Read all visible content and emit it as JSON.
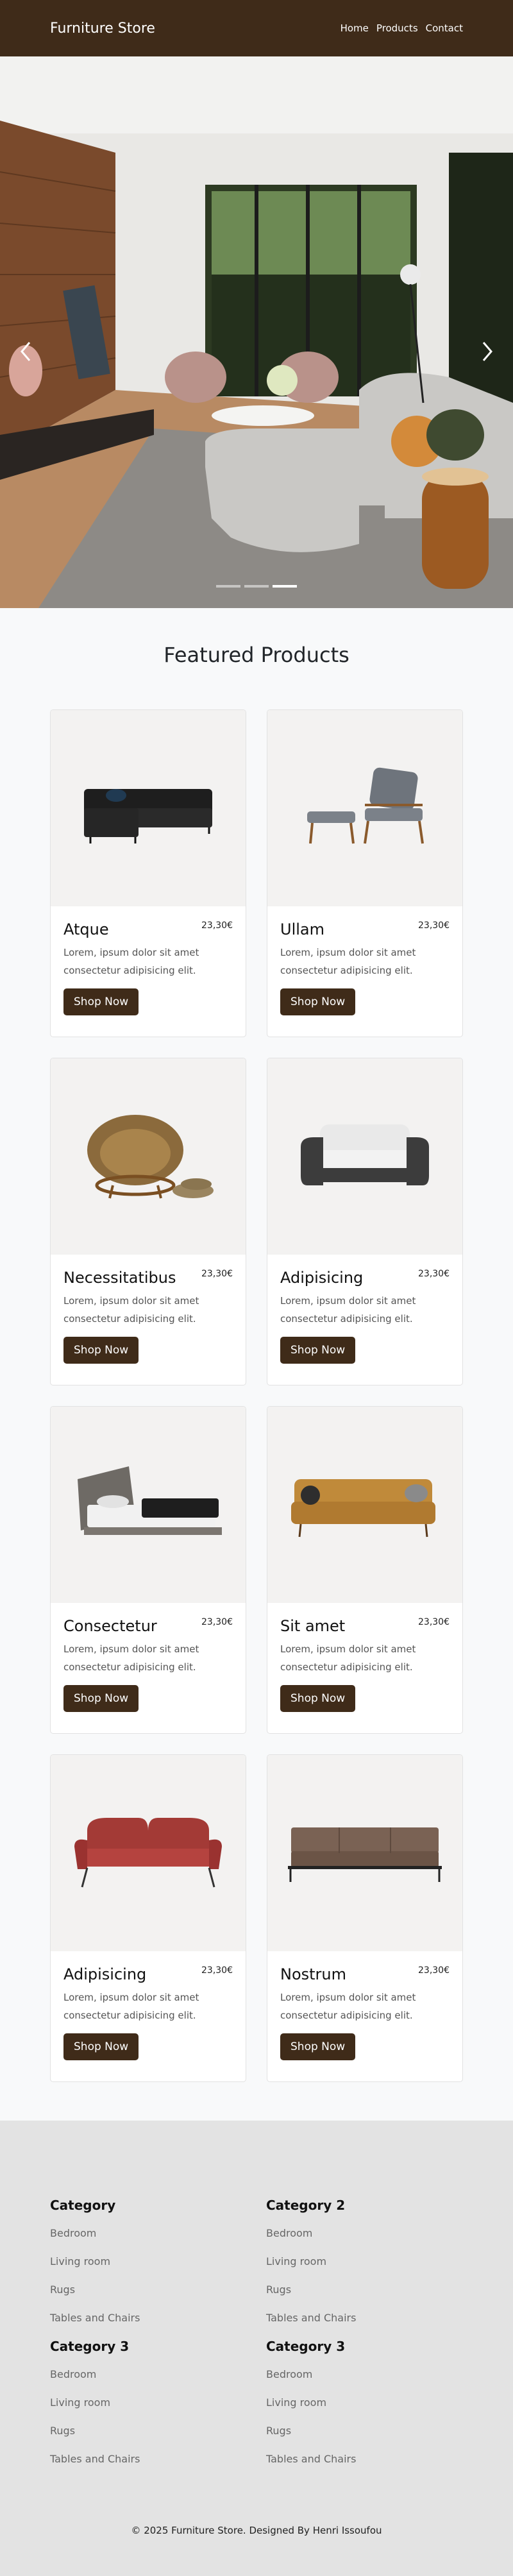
{
  "navbar": {
    "brand": "Furniture Store",
    "links": [
      "Home",
      "Products",
      "Contact"
    ]
  },
  "hero": {
    "image_icon": "living-room-photo",
    "slides_count": 3,
    "active_slide": 3
  },
  "products": {
    "title": "Featured Products",
    "items": [
      {
        "name": "Atque",
        "price": "23,30€",
        "description": "Lorem, ipsum dolor sit amet consectetur adipisicing elit.",
        "button": "Shop Now",
        "image_icon": "black-sofa-icon"
      },
      {
        "name": "Ullam",
        "price": "23,30€",
        "description": "Lorem, ipsum dolor sit amet consectetur adipisicing elit.",
        "button": "Shop Now",
        "image_icon": "armchair-ottoman-icon"
      },
      {
        "name": "Necessitatibus",
        "price": "23,30€",
        "description": "Lorem, ipsum dolor sit amet consectetur adipisicing elit.",
        "button": "Shop Now",
        "image_icon": "papasan-chair-icon"
      },
      {
        "name": "Adipisicing",
        "price": "23,30€",
        "description": "Lorem, ipsum dolor sit amet consectetur adipisicing elit.",
        "button": "Shop Now",
        "image_icon": "white-loveseat-icon"
      },
      {
        "name": "Consectetur",
        "price": "23,30€",
        "description": "Lorem, ipsum dolor sit amet consectetur adipisicing elit.",
        "button": "Shop Now",
        "image_icon": "bed-icon"
      },
      {
        "name": "Sit amet",
        "price": "23,30€",
        "description": "Lorem, ipsum dolor sit amet consectetur adipisicing elit.",
        "button": "Shop Now",
        "image_icon": "mustard-sofa-icon"
      },
      {
        "name": "Adipisicing",
        "price": "23,30€",
        "description": "Lorem, ipsum dolor sit amet consectetur adipisicing elit.",
        "button": "Shop Now",
        "image_icon": "red-loveseat-icon"
      },
      {
        "name": "Nostrum",
        "price": "23,30€",
        "description": "Lorem, ipsum dolor sit amet consectetur adipisicing elit.",
        "button": "Shop Now",
        "image_icon": "brown-sofa-icon"
      }
    ]
  },
  "footer": {
    "categories": [
      {
        "title": "Category",
        "links": [
          "Bedroom",
          "Living room",
          "Rugs",
          "Tables and Chairs"
        ]
      },
      {
        "title": "Category 2",
        "links": [
          "Bedroom",
          "Living room",
          "Rugs",
          "Tables and Chairs"
        ]
      },
      {
        "title": "Category 3",
        "links": [
          "Bedroom",
          "Living room",
          "Rugs",
          "Tables and Chairs"
        ]
      },
      {
        "title": "Category 3",
        "links": [
          "Bedroom",
          "Living room",
          "Rugs",
          "Tables and Chairs"
        ]
      }
    ],
    "copyright": "© 2025 Furniture Store. Designed By Henri Issoufou"
  },
  "colors": {
    "primary_brown": "#3f2b19",
    "page_bg": "#f8f9fa",
    "footer_bg": "#e3e3e3"
  }
}
